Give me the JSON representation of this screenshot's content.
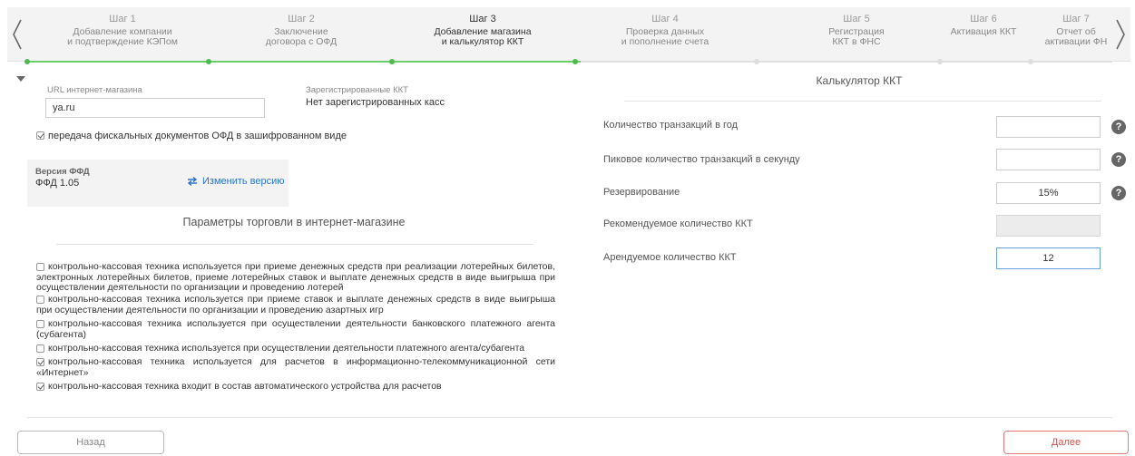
{
  "stepper": {
    "steps": [
      {
        "num": "Шаг 1",
        "title": "Добавление компании\nи подтверждение КЭПом"
      },
      {
        "num": "Шаг 2",
        "title": "Заключение\nдоговора с ОФД"
      },
      {
        "num": "Шаг 3",
        "title": "Добавление магазина\nи калькулятор ККТ"
      },
      {
        "num": "Шаг 4",
        "title": "Проверка данных\nи пополнение счета"
      },
      {
        "num": "Шаг 5",
        "title": "Регистрация\nККТ в ФНС"
      },
      {
        "num": "Шаг 6",
        "title": "Активация ККТ"
      },
      {
        "num": "Шаг 7",
        "title": "Отчет об\nактивации ФН"
      }
    ],
    "active_step": 3,
    "progress_color": "#4cbb4c"
  },
  "shop": {
    "url_label": "URL интернет-магазина",
    "url_value": "ya.ru",
    "kkt_label": "Зарегистрированные ККТ",
    "kkt_value": "Нет зарегистрированных касс",
    "encrypt_label": "передача фискальных документов ОФД в зашифрованном виде",
    "encrypt_checked": true
  },
  "ffd": {
    "label": "Версия ФФД",
    "value": "ФФД 1.05",
    "change_link": "Изменить версию"
  },
  "trade": {
    "title": "Параметры торговли в интернет-магазине",
    "options": [
      {
        "label": "контрольно-кассовая техника используется при приеме денежных средств при реализации лотерейных билетов, электронных лотерейных билетов, приеме лотерейных ставок и выплате денежных средств в виде выигрыша при осуществлении деятельности по организации и проведению лотерей",
        "checked": false
      },
      {
        "label": "контрольно-кассовая техника используется при приеме ставок и выплате денежных средств в виде выигрыша при осуществлении деятельности по организации и проведению азартных игр",
        "checked": false
      },
      {
        "label": "контрольно-кассовая техника используется при осуществлении деятельности банковского платежного агента (субагента)",
        "checked": false
      },
      {
        "label": "контрольно-кассовая техника используется при осуществлении деятельности платежного агента/субагента",
        "checked": false
      },
      {
        "label": "контрольно-кассовая техника используется для расчетов в информационно-телекоммуникационной сети «Интернет»",
        "checked": true
      },
      {
        "label": "контрольно-кассовая техника входит в состав автоматического устройства для расчетов",
        "checked": true
      }
    ]
  },
  "calculator": {
    "title": "Калькулятор ККТ",
    "fields": [
      {
        "label": "Количество транзакций в год",
        "value": ""
      },
      {
        "label": "Пиковое количество транзакций в секунду",
        "value": ""
      },
      {
        "label": "Резервирование",
        "value": "15%"
      },
      {
        "label": "Рекомендуемое количество ККТ",
        "value": ""
      },
      {
        "label": "Арендуемое количество ККТ",
        "value": "12"
      }
    ],
    "help_glyph": "?"
  },
  "footer": {
    "back_label": "Назад",
    "next_label": "Далее"
  },
  "colors": {
    "accent_green": "#4cbb4c",
    "link_blue": "#2c74c7",
    "danger_red": "#d9534f"
  }
}
